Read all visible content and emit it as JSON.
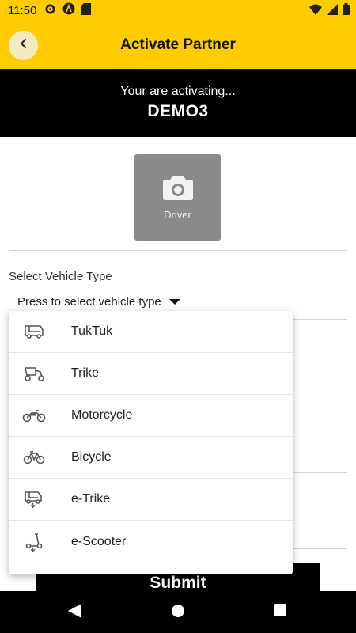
{
  "status": {
    "time": "11:50",
    "icons_left": [
      "gear-icon",
      "a-badge-icon",
      "sdcard-icon"
    ],
    "icons_right": [
      "wifi-icon",
      "signal-icon",
      "battery-icon"
    ]
  },
  "appbar": {
    "title": "Activate Partner",
    "back_icon": "back-arrow-icon",
    "accent": "#ffcc00"
  },
  "banner": {
    "subtitle": "Your are activating...",
    "name": "DEMO3"
  },
  "photo": {
    "label": "Driver",
    "icon": "camera-icon"
  },
  "vehicle": {
    "section_label": "Select Vehicle Type",
    "placeholder": "Press to select vehicle type",
    "options": [
      {
        "label": "TukTuk",
        "icon": "tuktuk-icon"
      },
      {
        "label": "Trike",
        "icon": "trike-icon"
      },
      {
        "label": "Motorcycle",
        "icon": "motorcycle-icon"
      },
      {
        "label": "Bicycle",
        "icon": "bicycle-icon"
      },
      {
        "label": "e-Trike",
        "icon": "e-trike-icon"
      },
      {
        "label": "e-Scooter",
        "icon": "e-scooter-icon"
      }
    ]
  },
  "submit": {
    "label": "Submit"
  },
  "navbar": {
    "buttons": [
      "back-triangle-icon",
      "home-circle-icon",
      "recents-square-icon"
    ]
  }
}
